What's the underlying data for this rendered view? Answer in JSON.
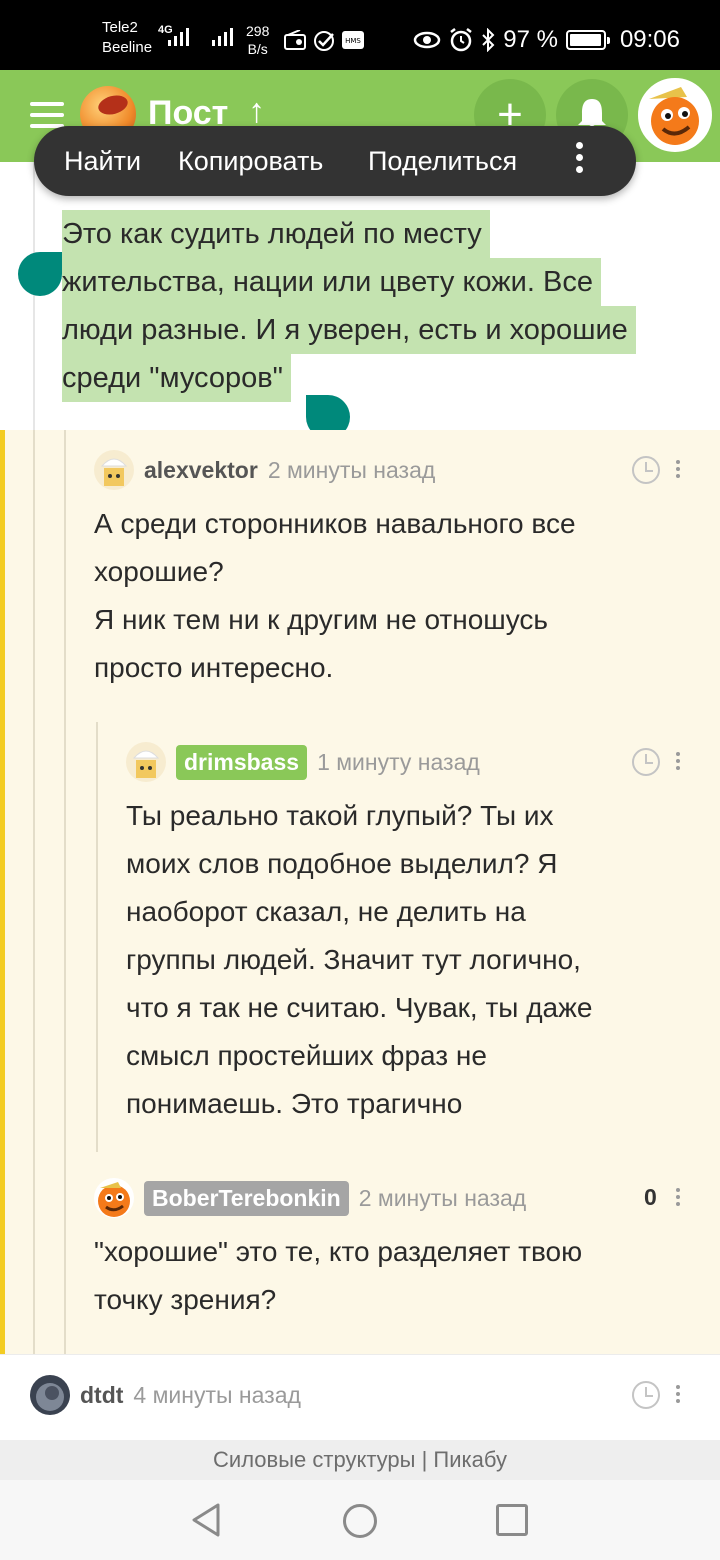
{
  "status_bar": {
    "carrier1": "Tele2",
    "carrier2": "Beeline",
    "network": "4G",
    "speed_value": "298",
    "speed_unit": "B/s",
    "battery": "97 %",
    "battery_level": 0.97,
    "time": "09:06"
  },
  "app_bar": {
    "title": "Пост",
    "up_arrow": "↑",
    "add_label": "+"
  },
  "context_menu": {
    "items": [
      "Найти",
      "Копировать",
      "Поделиться"
    ]
  },
  "selected_text": {
    "lines": [
      "Это как судить людей по месту",
      "жительства, нации или цвету кожи. Все",
      "люди разные. И я уверен, есть и хорошие",
      "среди \"мусоров\""
    ]
  },
  "comments": [
    {
      "user": "alexvektor",
      "time": "2 минуты назад",
      "lines": [
        "А среди сторонников навального все",
        "хорошие?",
        "Я ник тем ни к другим не отношусь",
        "просто интересно."
      ]
    },
    {
      "user": "drimsbass",
      "time": "1 минуту назад",
      "badge_color": "#8ac858",
      "lines": [
        "Ты реально такой глупый? Ты их",
        "моих слов подобное выделил? Я",
        "наоборот сказал, не делить на",
        "группы людей. Значит тут логично,",
        "что я так не считаю. Чувак, ты даже",
        "смысл простейших фраз не",
        "понимаешь. Это трагично"
      ]
    },
    {
      "user": "BoberTerebonkin",
      "time": "2 минуты назад",
      "rating": "0",
      "badge_color": "#a5a5a5",
      "lines": [
        "\"хорошие\" это те, кто разделяет твою",
        "точку зрения?"
      ]
    },
    {
      "user": "dtdt",
      "time": "4 минуты назад"
    }
  ],
  "footer": {
    "caption": "Силовые структуры | Пикабу"
  },
  "colors": {
    "brand_green": "#8ac858",
    "selection": "#c4e3b0",
    "handle": "#00897b",
    "thread_bg": "#fdf8e7",
    "accent_yellow": "#f3cc22"
  }
}
